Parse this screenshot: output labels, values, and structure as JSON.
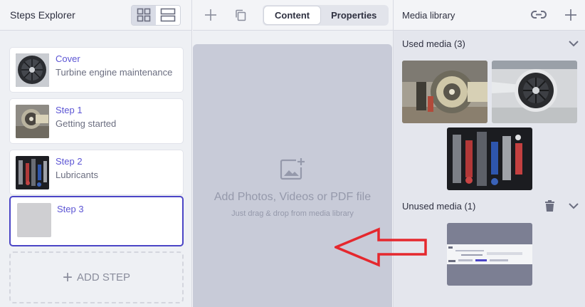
{
  "steps_explorer": {
    "title": "Steps Explorer",
    "steps": [
      {
        "name": "Cover",
        "description": "Turbine engine maintenance"
      },
      {
        "name": "Step 1",
        "description": "Getting started"
      },
      {
        "name": "Step 2",
        "description": "Lubricants"
      },
      {
        "name": "Step 3",
        "description": ""
      }
    ],
    "add_step_label": "ADD STEP"
  },
  "content": {
    "tabs": [
      {
        "label": "Content",
        "active": true
      },
      {
        "label": "Properties",
        "active": false
      }
    ],
    "drop_title": "Add Photos, Videos or PDF file",
    "drop_hint": "Just drag & drop from media library"
  },
  "media_library": {
    "title": "Media library",
    "used_label": "Used media (3)",
    "unused_label": "Unused media (1)"
  },
  "colors": {
    "accent": "#4b45c6",
    "arrow": "#e5282e"
  }
}
